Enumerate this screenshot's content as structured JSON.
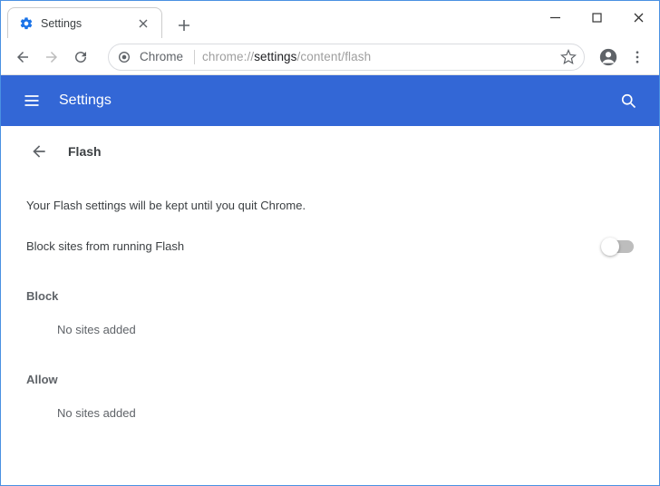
{
  "window": {
    "tab_title": "Settings",
    "favicon": "gear-icon"
  },
  "omnibox": {
    "origin_label": "Chrome",
    "url_prefix": "chrome://",
    "url_dark": "settings",
    "url_suffix": "/content/flash"
  },
  "appbar": {
    "title": "Settings"
  },
  "content": {
    "page_title": "Flash",
    "notice": "Your Flash settings will be kept until you quit Chrome.",
    "toggle_label": "Block sites from running Flash",
    "toggle_on": false,
    "sections": {
      "block": {
        "label": "Block",
        "empty_text": "No sites added"
      },
      "allow": {
        "label": "Allow",
        "empty_text": "No sites added"
      }
    }
  },
  "colors": {
    "accent": "#3367d6"
  }
}
